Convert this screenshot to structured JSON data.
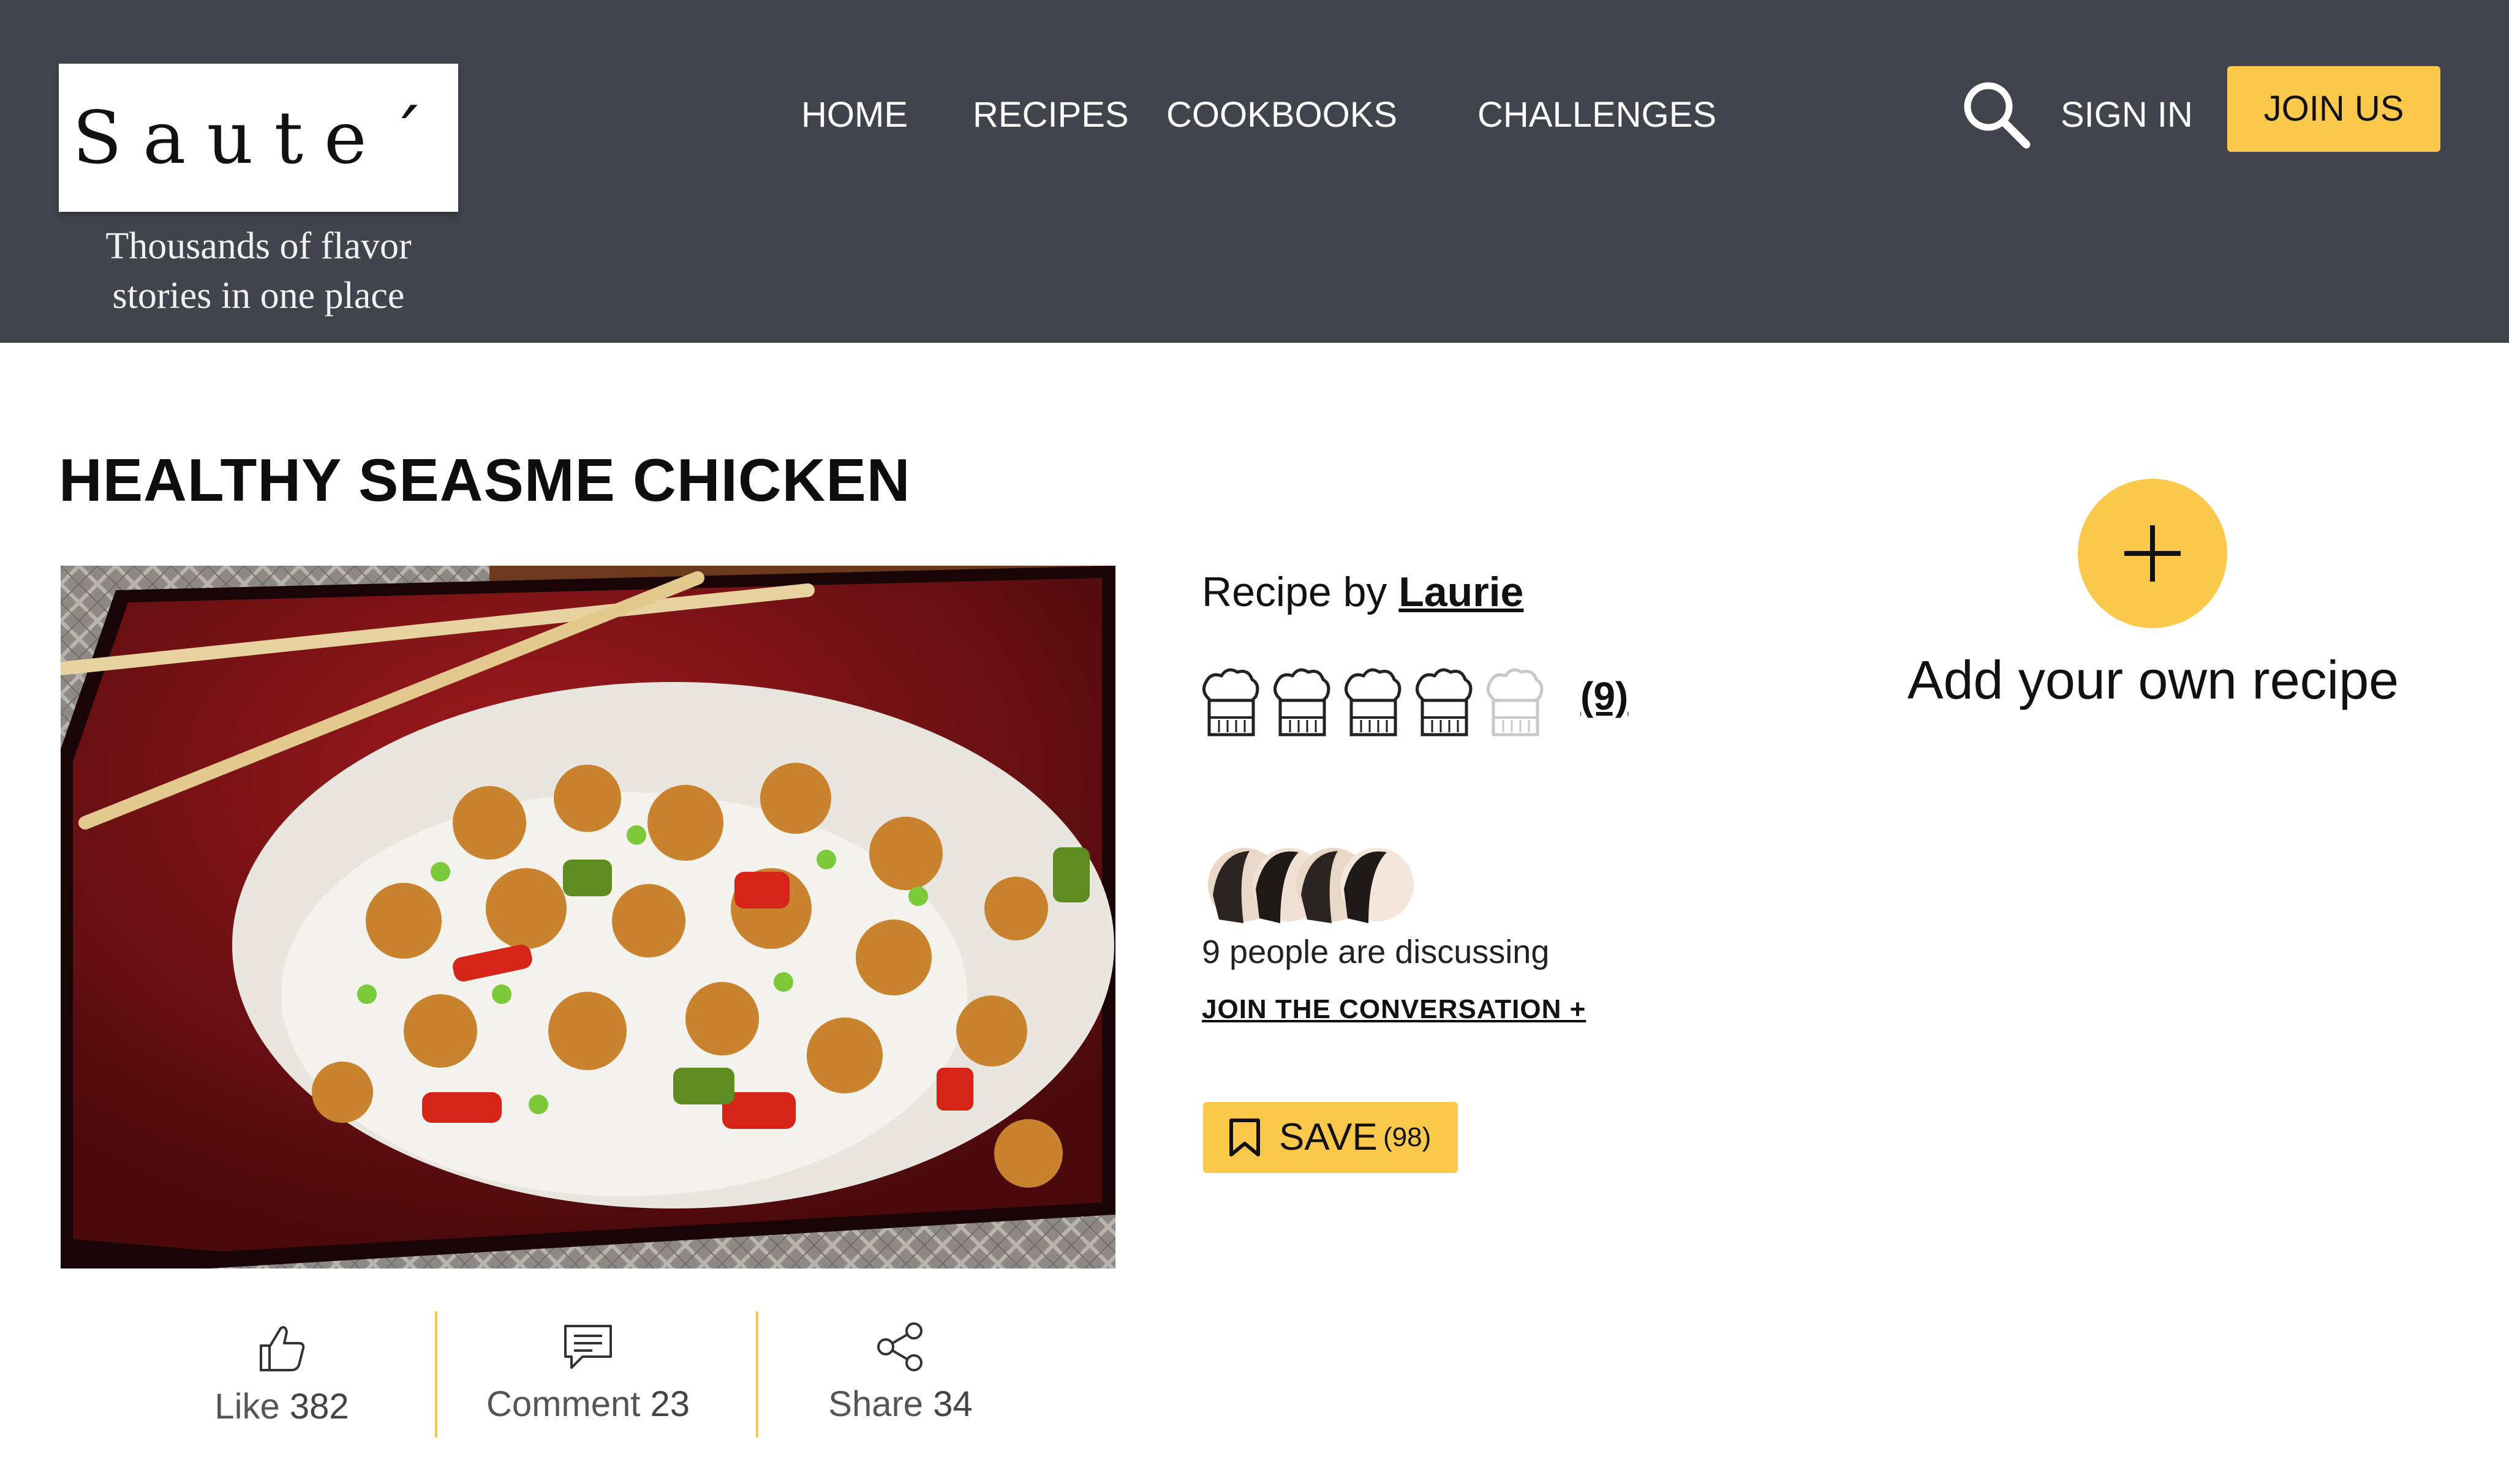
{
  "brand": {
    "logo": "Saute´",
    "tagline_line1": "Thousands of flavor",
    "tagline_line2": "stories in one place"
  },
  "nav": {
    "items": [
      "HOME",
      "RECIPES",
      "COOKBOOKS",
      "CHALLENGES"
    ],
    "sign_in": "SIGN IN",
    "join": "JOIN US"
  },
  "recipe": {
    "title": "HEALTHY SEASME CHICKEN",
    "by_prefix": "Recipe by",
    "author": "Laurie",
    "rating": 4,
    "rating_max": 5,
    "rating_count": "(9)",
    "discussing": "9 people are discussing",
    "join_conversation": "JOIN THE CONVERSATION  +",
    "save_label": "SAVE",
    "save_count": "(98)"
  },
  "actions": {
    "like_label": "Like",
    "like_count": "382",
    "comment_label": "Comment",
    "comment_count": "23",
    "share_label": "Share",
    "share_count": "34"
  },
  "add_recipe": {
    "label": "Add your own recipe"
  },
  "colors": {
    "header_bg": "#41444c",
    "accent": "#fac94c"
  },
  "icons": [
    "search-icon",
    "chef-hat-icon",
    "bookmark-icon",
    "plus-icon",
    "thumbs-up-icon",
    "comment-icon",
    "share-icon"
  ]
}
